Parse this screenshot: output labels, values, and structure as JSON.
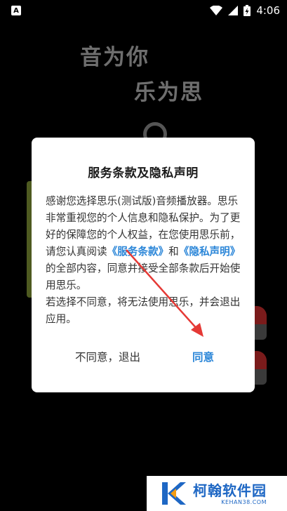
{
  "status_bar": {
    "time": "4:06",
    "icons": [
      "wifi-icon",
      "signal-icon",
      "battery-charging-icon"
    ],
    "app_icon": "A"
  },
  "background": {
    "slogan_line1": "音为你",
    "slogan_line2": "乐为思"
  },
  "dialog": {
    "title": "服务条款及隐私声明",
    "body_part1": "感谢您选择思乐(测试版)音频播放器。思乐非常重视您的个人信息和隐私保护。为了更好的保障您的个人权益，在您使用思乐前，请您认真阅读",
    "terms_link": "《服务条款》",
    "body_and": "和",
    "privacy_link": "《隐私声明》",
    "body_part2": "的全部内容，同意并接受全部条款后开始使用思乐。",
    "body_part3": "若选择不同意，将无法使用思乐，并会退出应用。",
    "decline_label": "不同意，退出",
    "agree_label": "同意"
  },
  "watermark": {
    "name": "柯翰软件园",
    "url": "KEHAN38.COM",
    "logo_letter": "K"
  },
  "colors": {
    "accent": "#2b86d8",
    "arrow": "#e53935",
    "background": "#000000",
    "dialog_bg": "#ffffff"
  }
}
